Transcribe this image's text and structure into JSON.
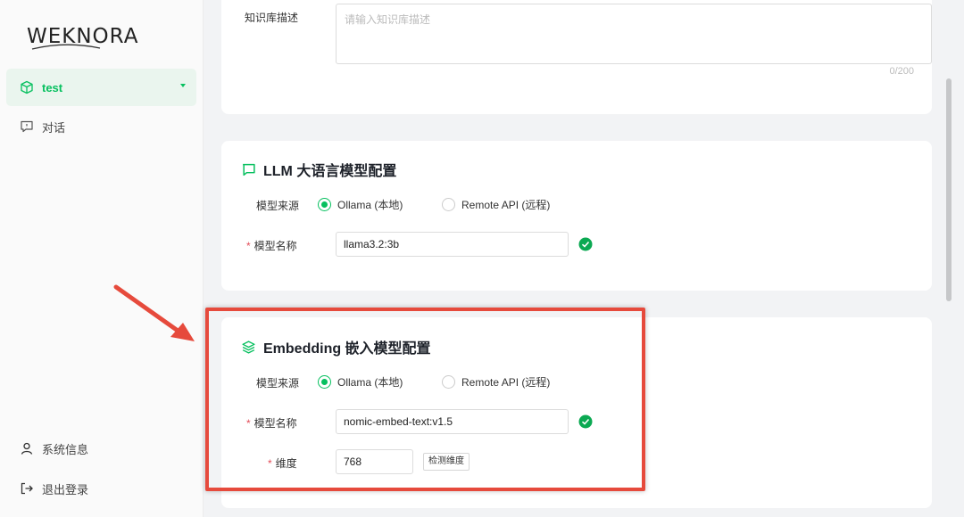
{
  "sidebar": {
    "logo": "WEKNORA",
    "items": [
      {
        "label": "test",
        "icon": "cube-icon"
      },
      {
        "label": "对话",
        "icon": "chat-icon"
      }
    ],
    "bottom": [
      {
        "label": "系统信息",
        "icon": "user-icon"
      },
      {
        "label": "退出登录",
        "icon": "logout-icon"
      }
    ]
  },
  "kb": {
    "desc_label": "知识库描述",
    "desc_placeholder": "请输入知识库描述",
    "counter": "0/200"
  },
  "llm": {
    "title": "LLM 大语言模型配置",
    "source_label": "模型来源",
    "option_local": "Ollama (本地)",
    "option_remote": "Remote API (远程)",
    "selected": "local",
    "name_label": "模型名称",
    "name_value": "llama3.2:3b"
  },
  "embedding": {
    "title": "Embedding 嵌入模型配置",
    "source_label": "模型来源",
    "option_local": "Ollama (本地)",
    "option_remote": "Remote API (远程)",
    "selected": "local",
    "name_label": "模型名称",
    "name_value": "nomic-embed-text:v1.5",
    "dim_label": "维度",
    "dim_value": "768",
    "detect_button": "检测维度"
  },
  "colors": {
    "accent": "#07c05f",
    "required": "#e34d59",
    "annotation": "#e64a3c"
  }
}
